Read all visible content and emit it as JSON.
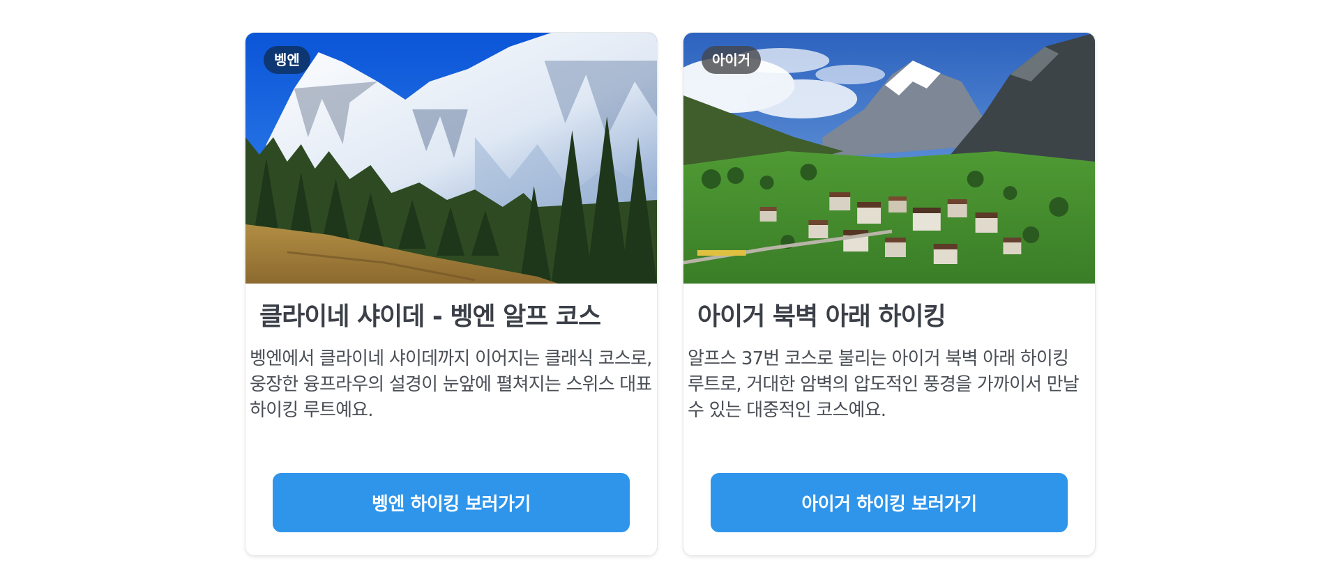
{
  "cards": [
    {
      "badge": "벵엔",
      "title": "클라이네 샤이데 - 벵엔 알프 코스",
      "description": "벵엔에서 클라이네 샤이데까지 이어지는 클래식 코스로, 웅장한 융프라우의 설경이 눈앞에 펼쳐지는 스위스 대표 하이킹 루트예요.",
      "button_label": "벵엔 하이킹 보러가기",
      "image_alt": "snowy mountain with pine forest"
    },
    {
      "badge": "아이거",
      "title": "아이거 북벽 아래 하이킹",
      "description": "알프스 37번 코스로 불리는 아이거 북벽 아래 하이킹 루트로, 거대한 암벽의 압도적인 풍경을 가까이서 만날 수 있는 대중적인 코스예요.",
      "button_label": "아이거 하이킹 보러가기",
      "image_alt": "alpine village in green valley below peaks"
    }
  ],
  "colors": {
    "button": "#2f95ea",
    "title_text": "#3b3f47",
    "body_text": "#4a4e55"
  }
}
